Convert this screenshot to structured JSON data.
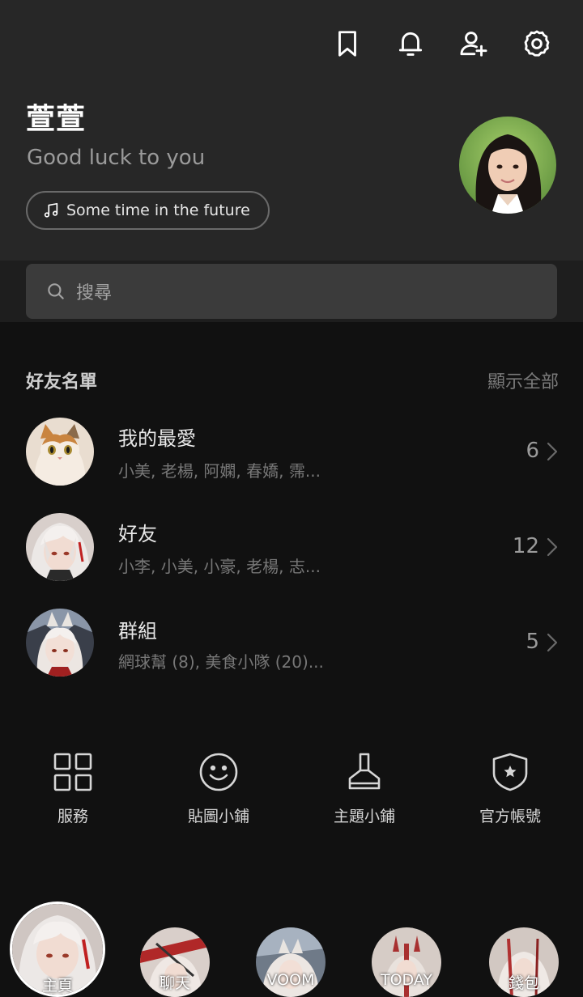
{
  "header": {
    "icons": [
      "bookmark-icon",
      "bell-icon",
      "add-friend-icon",
      "gear-icon"
    ],
    "profile": {
      "name": "萱萱",
      "status": "Good luck to you",
      "music": "Some time in the future"
    }
  },
  "search": {
    "placeholder": "搜尋"
  },
  "friends": {
    "title": "好友名單",
    "show_all": "顯示全部",
    "rows": [
      {
        "title": "我的最愛",
        "subtitle": "小美, 老楊, 阿嫻, 春嬌, 霈...",
        "count": "6"
      },
      {
        "title": "好友",
        "subtitle": "小李, 小美, 小豪, 老楊, 志...",
        "count": "12"
      },
      {
        "title": "群組",
        "subtitle": "網球幫 (8), 美食小隊 (20)...",
        "count": "5"
      }
    ]
  },
  "services": [
    {
      "label": "服務",
      "icon": "grid-icon"
    },
    {
      "label": "貼圖小鋪",
      "icon": "smiley-icon"
    },
    {
      "label": "主題小鋪",
      "icon": "brush-icon"
    },
    {
      "label": "官方帳號",
      "icon": "shield-star-icon"
    }
  ],
  "bottom_nav": [
    {
      "label": "主頁",
      "active": true
    },
    {
      "label": "聊天"
    },
    {
      "label": "VOOM"
    },
    {
      "label": "TODAY"
    },
    {
      "label": "錢包"
    }
  ],
  "colors": {
    "header_bg": "#272727",
    "body_bg": "#111111",
    "search_bg": "#3b3b3b",
    "muted_text": "#777777"
  }
}
